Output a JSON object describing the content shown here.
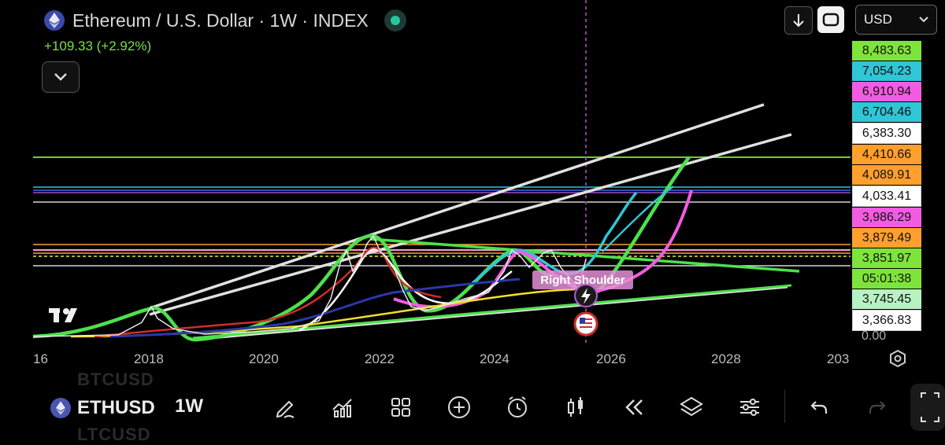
{
  "header": {
    "title": "Ethereum / U.S. Dollar · 1W · INDEX",
    "change": "+109.33 (+2.92%)",
    "currency": "USD"
  },
  "price_labels": [
    {
      "text": "8,483.63",
      "color": "#7ee33b"
    },
    {
      "text": "7,054.23",
      "color": "#2fc6d6"
    },
    {
      "text": "6,910.94",
      "color": "#f25ce0"
    },
    {
      "text": "6,704.46",
      "color": "#2fc6d6"
    },
    {
      "text": "6,383.30",
      "color": "#ffffff"
    },
    {
      "text": "4,410.66",
      "color": "#ff9f2e"
    },
    {
      "text": "4,089.91",
      "color": "#ff9f2e"
    },
    {
      "text": "4,033.41",
      "color": "#ffffff"
    },
    {
      "text": "3,986.29",
      "color": "#f25ce0"
    },
    {
      "text": "3,879.49",
      "color": "#ff9f2e"
    },
    {
      "text": "3,851.97",
      "color": "#7ee33b"
    },
    {
      "text": "05:01:38",
      "color": "#7ee33b"
    },
    {
      "text": "3,745.45",
      "color": "#b7f2c2"
    },
    {
      "text": "3,366.83",
      "color": "#ffffff"
    }
  ],
  "zero_label": "0.00",
  "years": [
    "16",
    "2018",
    "2020",
    "2022",
    "2024",
    "2026",
    "2028",
    "203"
  ],
  "annotation": "Right Shoulder",
  "toolbar": {
    "symbol": "ETHUSD",
    "timeframe": "1W",
    "ghost_above": "BTCUSD",
    "ghost_below": "LTCUSD",
    "tools": [
      "draw-icon",
      "indicators-icon",
      "grid-icon",
      "add-icon",
      "alert-icon",
      "candle-icon",
      "replay-icon",
      "layers-icon",
      "settings-sliders-icon",
      "undo-icon",
      "redo-icon"
    ]
  },
  "colors": {
    "green": "#4ce14b",
    "cyan": "#2fc6d6",
    "magenta": "#f25ce0",
    "orange": "#ff9f2e",
    "white": "#e8e8e8",
    "accent_status": "#26c6a1"
  }
}
